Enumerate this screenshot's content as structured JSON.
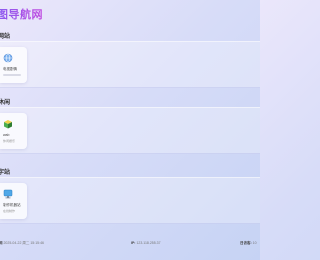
{
  "site": {
    "title": "图导航网"
  },
  "sections": [
    {
      "title": "网站",
      "card": {
        "name": "电视剧情",
        "desc": "",
        "icon": "globe-icon"
      }
    },
    {
      "title": "休闲",
      "card": {
        "name": "wab",
        "desc": "休闲娱乐",
        "icon": "cube-icon"
      }
    },
    {
      "title": "字站",
      "card": {
        "name": "制作机器站",
        "desc": "在线制作",
        "icon": "monitor-icon"
      }
    }
  ],
  "footer": {
    "date_label": "间",
    "date_value": "2025-04-22 周二 15:15:46",
    "ip_label": "IP:",
    "ip_value": "123.118.255.37",
    "visits_label": "日访客:",
    "visits_value": "10"
  },
  "colors": {
    "title_gradient_start": "#8a5cf0",
    "title_gradient_end": "#c04ae0",
    "background_start": "#ebe7fb",
    "background_end": "#c6d3f4"
  }
}
